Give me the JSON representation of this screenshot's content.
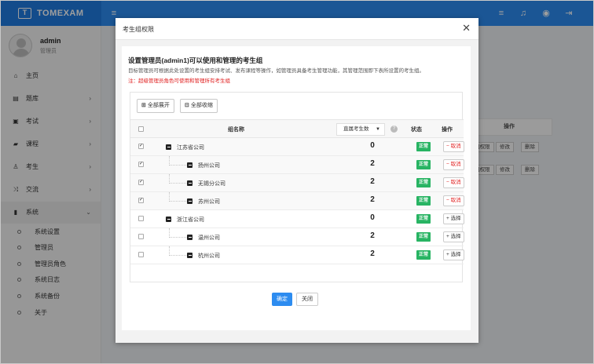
{
  "app": {
    "logo_text": "T",
    "name": "TOMEXAM"
  },
  "topbar": {
    "icons": [
      "menu-icon",
      "list-icon",
      "bell-icon",
      "user-circle-icon",
      "logout-icon"
    ],
    "menu_glyph": "≡",
    "list_glyph": "≡",
    "bell_glyph": "♫",
    "user_glyph": "◉",
    "logout_glyph": "⇥"
  },
  "user": {
    "name": "admin",
    "role": "管理员"
  },
  "sidebar": {
    "items": [
      {
        "icon": "home-icon",
        "glyph": "⌂",
        "label": "主页",
        "arrow": ""
      },
      {
        "icon": "database-icon",
        "glyph": "▤",
        "label": "题库",
        "arrow": "›"
      },
      {
        "icon": "calendar-icon",
        "glyph": "▣",
        "label": "考试",
        "arrow": "›"
      },
      {
        "icon": "book-icon",
        "glyph": "▰",
        "label": "课程",
        "arrow": "›"
      },
      {
        "icon": "user-icon",
        "glyph": "♙",
        "label": "考生",
        "arrow": "›"
      },
      {
        "icon": "shuffle-icon",
        "glyph": "⤨",
        "label": "交流",
        "arrow": "›"
      },
      {
        "icon": "phone-icon",
        "glyph": "▮",
        "label": "系统",
        "arrow": "⌄"
      }
    ],
    "sub_items": [
      "系统设置",
      "管理员",
      "管理员角色",
      "系统日志",
      "系统备份",
      "关于"
    ]
  },
  "background": {
    "actions_header": "操作",
    "row_buttons": [
      "组权限",
      "修改",
      "删除"
    ]
  },
  "dialog": {
    "title": "考生组权限",
    "close_glyph": "✕",
    "heading": "设置管理员(admin1)可以使用和管理的考生组",
    "description": "目标管理员可根据此处设置的考生组安排考试、发布课程等操作，如管理员具备考生管理功能，其管理范围即下表所设置的考生组。",
    "warning": "注：超级管理员角色可使用和管理所有考生组",
    "toolbar": {
      "expand_all": "全部展开",
      "collapse_all": "全部收缩"
    },
    "table": {
      "col_name": "组名称",
      "col_count_select": "直属考生数",
      "col_status": "状态",
      "col_action": "操作",
      "rows": [
        {
          "name": "江苏省公司",
          "count": "0",
          "status": "正常",
          "action": "取消",
          "checked": true,
          "level": 0
        },
        {
          "name": "扬州公司",
          "count": "2",
          "status": "正常",
          "action": "取消",
          "checked": true,
          "level": 1
        },
        {
          "name": "无锡分公司",
          "count": "2",
          "status": "正常",
          "action": "取消",
          "checked": true,
          "level": 1
        },
        {
          "name": "苏州公司",
          "count": "2",
          "status": "正常",
          "action": "取消",
          "checked": true,
          "level": 1
        },
        {
          "name": "浙江省公司",
          "count": "0",
          "status": "正常",
          "action": "选择",
          "checked": false,
          "level": 0
        },
        {
          "name": "温州公司",
          "count": "2",
          "status": "正常",
          "action": "选择",
          "checked": false,
          "level": 1
        },
        {
          "name": "杭州公司",
          "count": "2",
          "status": "正常",
          "action": "选择",
          "checked": false,
          "level": 1
        }
      ]
    },
    "confirm": "确定",
    "close": "关闭"
  },
  "colors": {
    "primary": "#2d8cf0",
    "success": "#28b463",
    "danger": "#e02020"
  }
}
